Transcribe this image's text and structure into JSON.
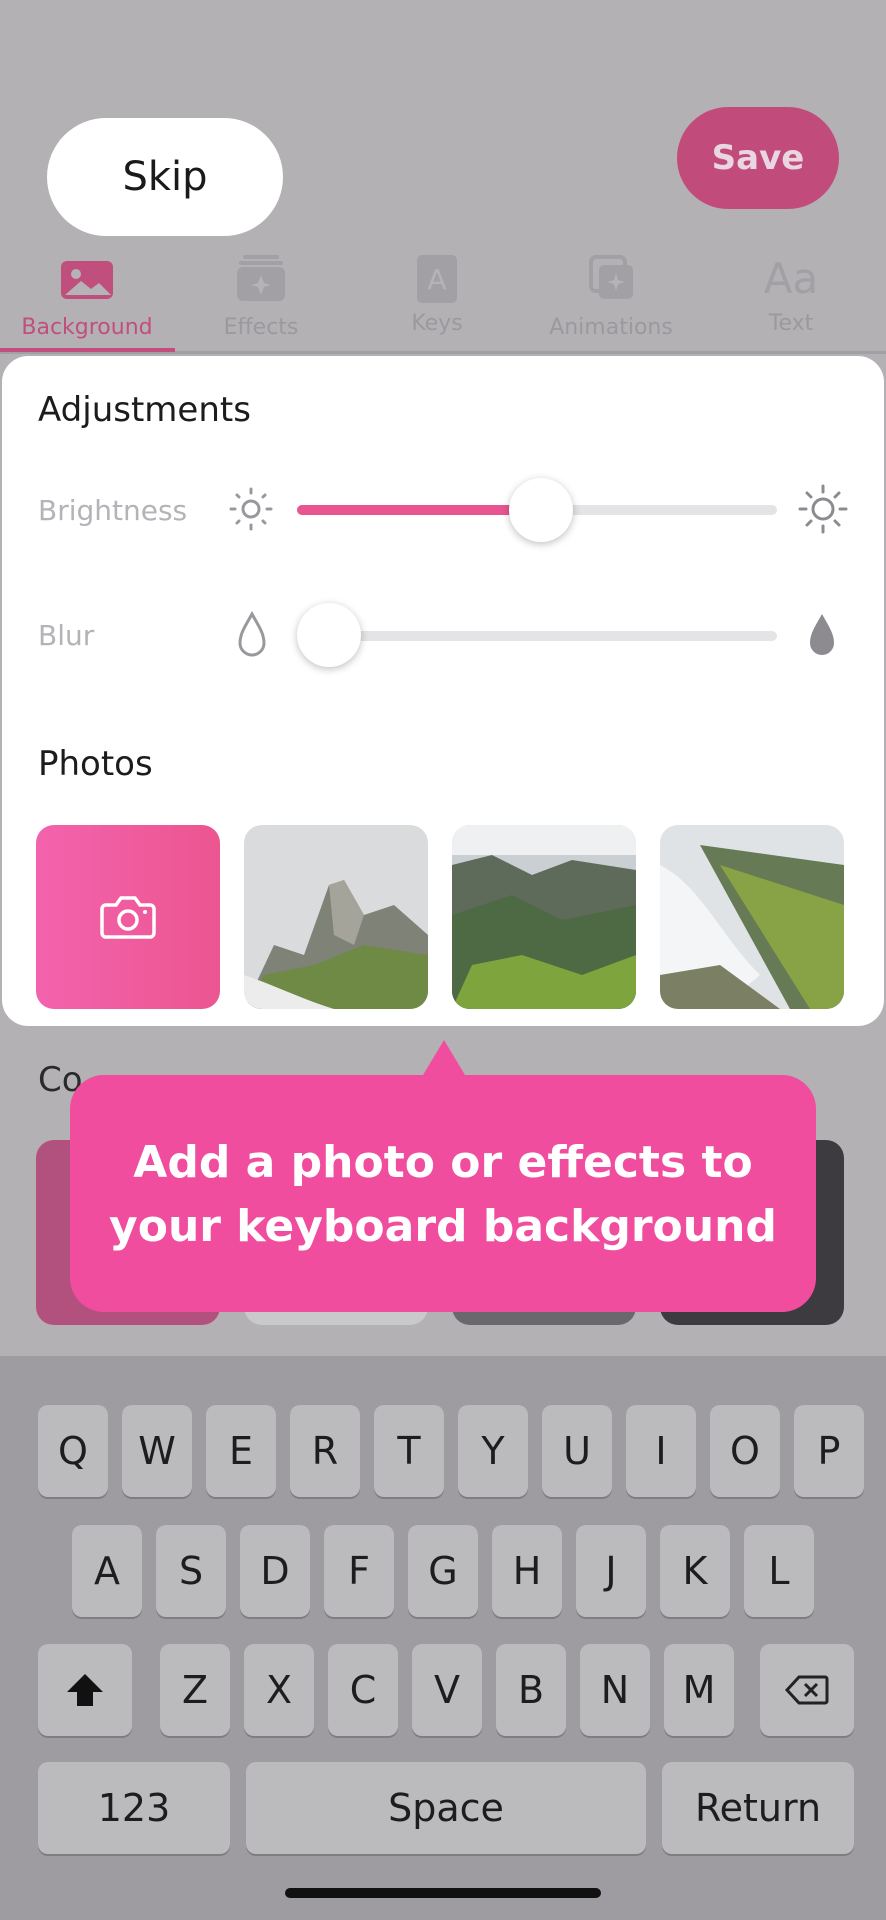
{
  "header": {
    "skip_label": "Skip",
    "save_label": "Save"
  },
  "tabs": [
    {
      "label": "Background",
      "icon": "image-icon",
      "active": true
    },
    {
      "label": "Effects",
      "icon": "effects-icon",
      "active": false
    },
    {
      "label": "Keys",
      "icon": "key-icon",
      "active": false
    },
    {
      "label": "Animations",
      "icon": "animations-icon",
      "active": false
    },
    {
      "label": "Text",
      "icon": "text-aa-icon",
      "active": false
    }
  ],
  "tab_icon_glyphs": {
    "keys": "A",
    "text": "Aa"
  },
  "adjustments": {
    "title": "Adjustments",
    "brightness": {
      "label": "Brightness",
      "value_percent": 50
    },
    "blur": {
      "label": "Blur",
      "value_percent": 0
    }
  },
  "photos": {
    "title": "Photos",
    "items": [
      "camera-tile",
      "mountain-peak-fog",
      "green-valley",
      "ridge-clouds"
    ]
  },
  "colors": {
    "title_visible_fragment": "Co"
  },
  "tooltip": {
    "line1": "Add a photo or effects to",
    "line2": "your keyboard background"
  },
  "keyboard": {
    "row1": [
      "Q",
      "W",
      "E",
      "R",
      "T",
      "Y",
      "U",
      "I",
      "O",
      "P"
    ],
    "row2": [
      "A",
      "S",
      "D",
      "F",
      "G",
      "H",
      "J",
      "K",
      "L"
    ],
    "row3": [
      "Z",
      "X",
      "C",
      "V",
      "B",
      "N",
      "M"
    ],
    "numbers_label": "123",
    "space_label": "Space",
    "return_label": "Return"
  },
  "colors_accent": {
    "brand_pink": "#f04d9e",
    "slider_fill": "#e85590"
  }
}
